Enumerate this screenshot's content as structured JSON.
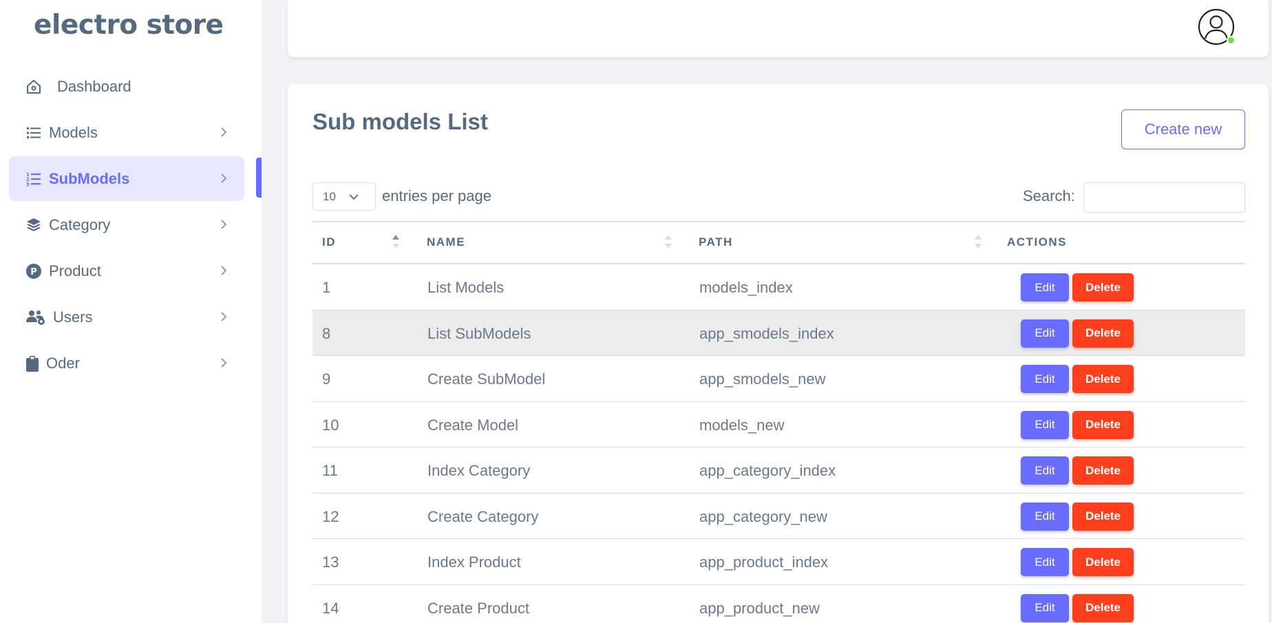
{
  "brand": "electro store",
  "colors": {
    "accent": "#696cff",
    "danger": "#ff3e1d",
    "online": "#71dd37",
    "text": "#566a7f"
  },
  "sidebar": {
    "items": [
      {
        "label": "Dashboard",
        "icon": "home-icon",
        "active": false,
        "chevron": false
      },
      {
        "label": "Models",
        "icon": "list-icon",
        "active": false,
        "chevron": true
      },
      {
        "label": "SubModels",
        "icon": "numbered-list-icon",
        "active": true,
        "chevron": true
      },
      {
        "label": "Category",
        "icon": "layers-icon",
        "active": false,
        "chevron": true
      },
      {
        "label": "Product",
        "icon": "product-p-icon",
        "active": false,
        "chevron": true
      },
      {
        "label": "Users",
        "icon": "users-gear-icon",
        "active": false,
        "chevron": true
      },
      {
        "label": "Oder",
        "icon": "clipboard-icon",
        "active": false,
        "chevron": true
      }
    ]
  },
  "header": {
    "avatar_icon": "user-avatar-icon",
    "status": "online"
  },
  "main": {
    "title": "Sub models List",
    "create_label": "Create new",
    "entries": {
      "selected": "10",
      "label": "entries per page"
    },
    "search": {
      "label": "Search:",
      "value": ""
    },
    "columns": [
      "ID",
      "NAME",
      "PATH",
      "ACTIONS"
    ],
    "rows": [
      {
        "id": "1",
        "name": "List Models",
        "path": "models_index"
      },
      {
        "id": "8",
        "name": "List SubModels",
        "path": "app_smodels_index"
      },
      {
        "id": "9",
        "name": "Create SubModel",
        "path": "app_smodels_new"
      },
      {
        "id": "10",
        "name": "Create Model",
        "path": "models_new"
      },
      {
        "id": "11",
        "name": "Index Category",
        "path": "app_category_index"
      },
      {
        "id": "12",
        "name": "Create Category",
        "path": "app_category_new"
      },
      {
        "id": "13",
        "name": "Index Product",
        "path": "app_product_index"
      },
      {
        "id": "14",
        "name": "Create Product",
        "path": "app_product_new"
      }
    ],
    "edit_label": "Edit",
    "delete_label": "Delete"
  }
}
